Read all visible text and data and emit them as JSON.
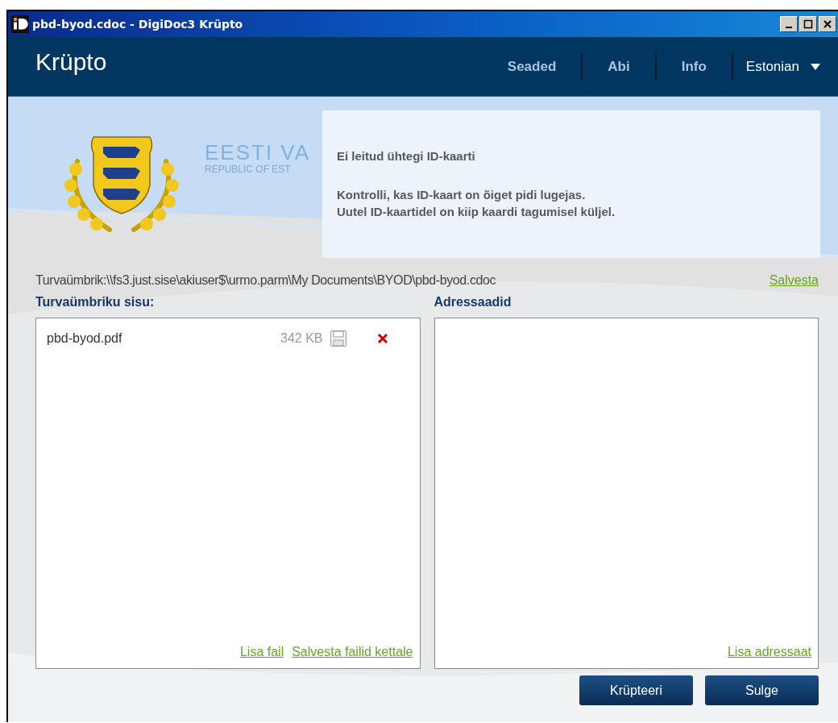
{
  "window": {
    "title": "pbd-byod.cdoc - DigiDoc3 Krüpto"
  },
  "header": {
    "app_name": "Krüpto",
    "nav": [
      "Seaded",
      "Abi",
      "Info"
    ],
    "language": "Estonian"
  },
  "banner": {
    "logo_title": "EESTI VA",
    "logo_subtitle": "REPUBLIC OF EST"
  },
  "message": {
    "title": "Ei leitud ühtegi ID-kaarti",
    "lines": [
      "Kontrolli, kas ID-kaart on õiget pidi lugejas.",
      "Uutel ID-kaartidel on kiip kaardi tagumisel küljel."
    ]
  },
  "path": {
    "text": "Turvaümbrik:\\\\fs3.just.sise\\akiuser$\\urmo.parm\\My Documents\\BYOD\\pbd-byod.cdoc",
    "save_link": "Salvesta"
  },
  "contents": {
    "heading": "Turvaümbriku sisu:",
    "files": [
      {
        "name": "pbd-byod.pdf",
        "size": "342 KB"
      }
    ],
    "links": [
      "Lisa fail",
      "Salvesta failid kettale"
    ]
  },
  "recipients": {
    "heading": "Adressaadid",
    "links": [
      "Lisa adressaat"
    ]
  },
  "buttons": [
    "Krüpteeri",
    "Sulge"
  ]
}
